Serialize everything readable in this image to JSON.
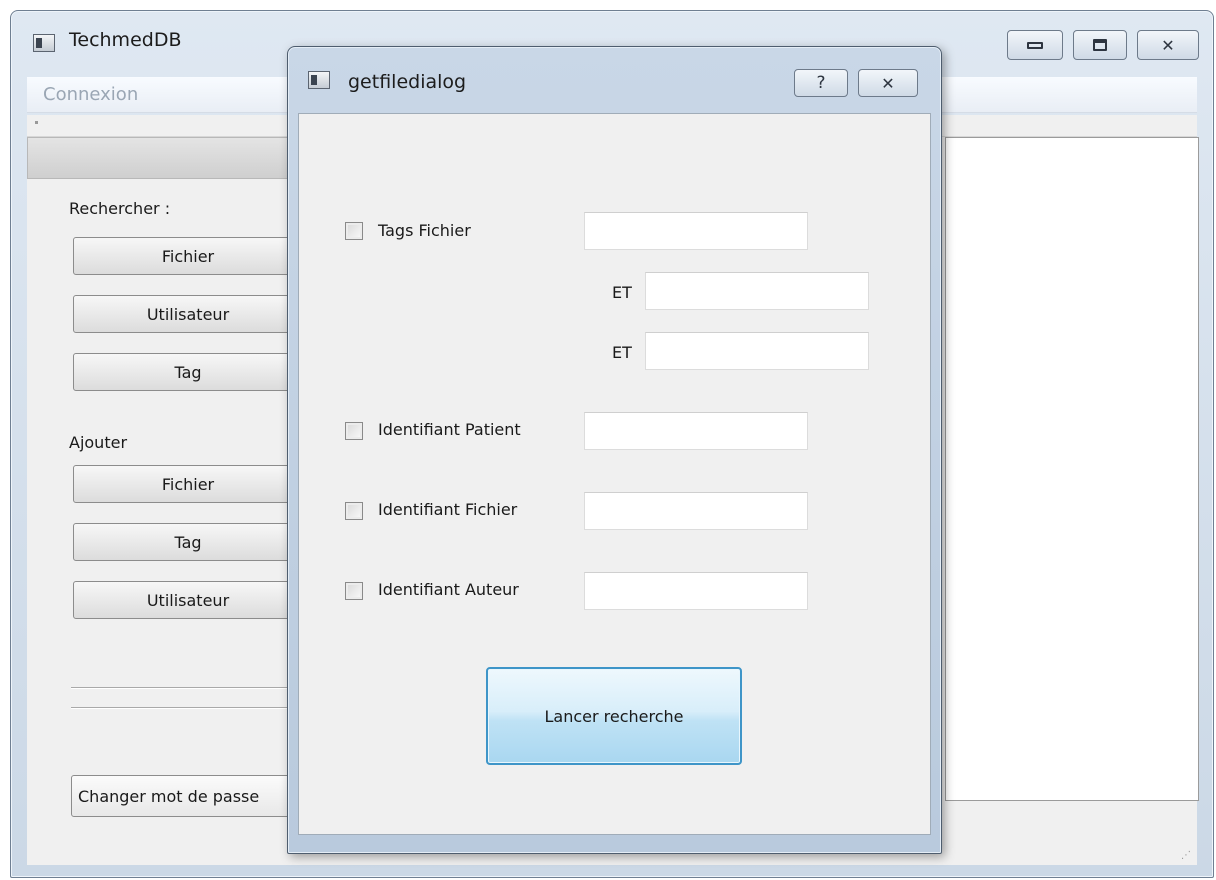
{
  "main_window": {
    "title": "TechmedDB",
    "menu": {
      "connexion": "Connexion"
    },
    "left_panel": {
      "search_label": "Rechercher :",
      "search_buttons": {
        "fichier": "Fichier",
        "utilisateur": "Utilisateur",
        "tag": "Tag"
      },
      "add_label": "Ajouter",
      "add_buttons": {
        "fichier": "Fichier",
        "tag": "Tag",
        "utilisateur": "Utilisateur"
      },
      "change_password": "Changer mot de passe"
    }
  },
  "dialog": {
    "title": "getfiledialog",
    "help_glyph": "?",
    "fields": {
      "tags_fichier": "Tags Fichier",
      "et": "ET",
      "identifiant_patient": "Identifiant Patient",
      "identifiant_fichier": "Identifiant Fichier",
      "identifiant_auteur": "Identifiant Auteur"
    },
    "submit": "Lancer recherche"
  },
  "icons": {
    "app": "app-window-icon",
    "minimize": "minimize-icon",
    "maximize": "maximize-icon",
    "close": "close-icon",
    "help": "help-icon"
  }
}
